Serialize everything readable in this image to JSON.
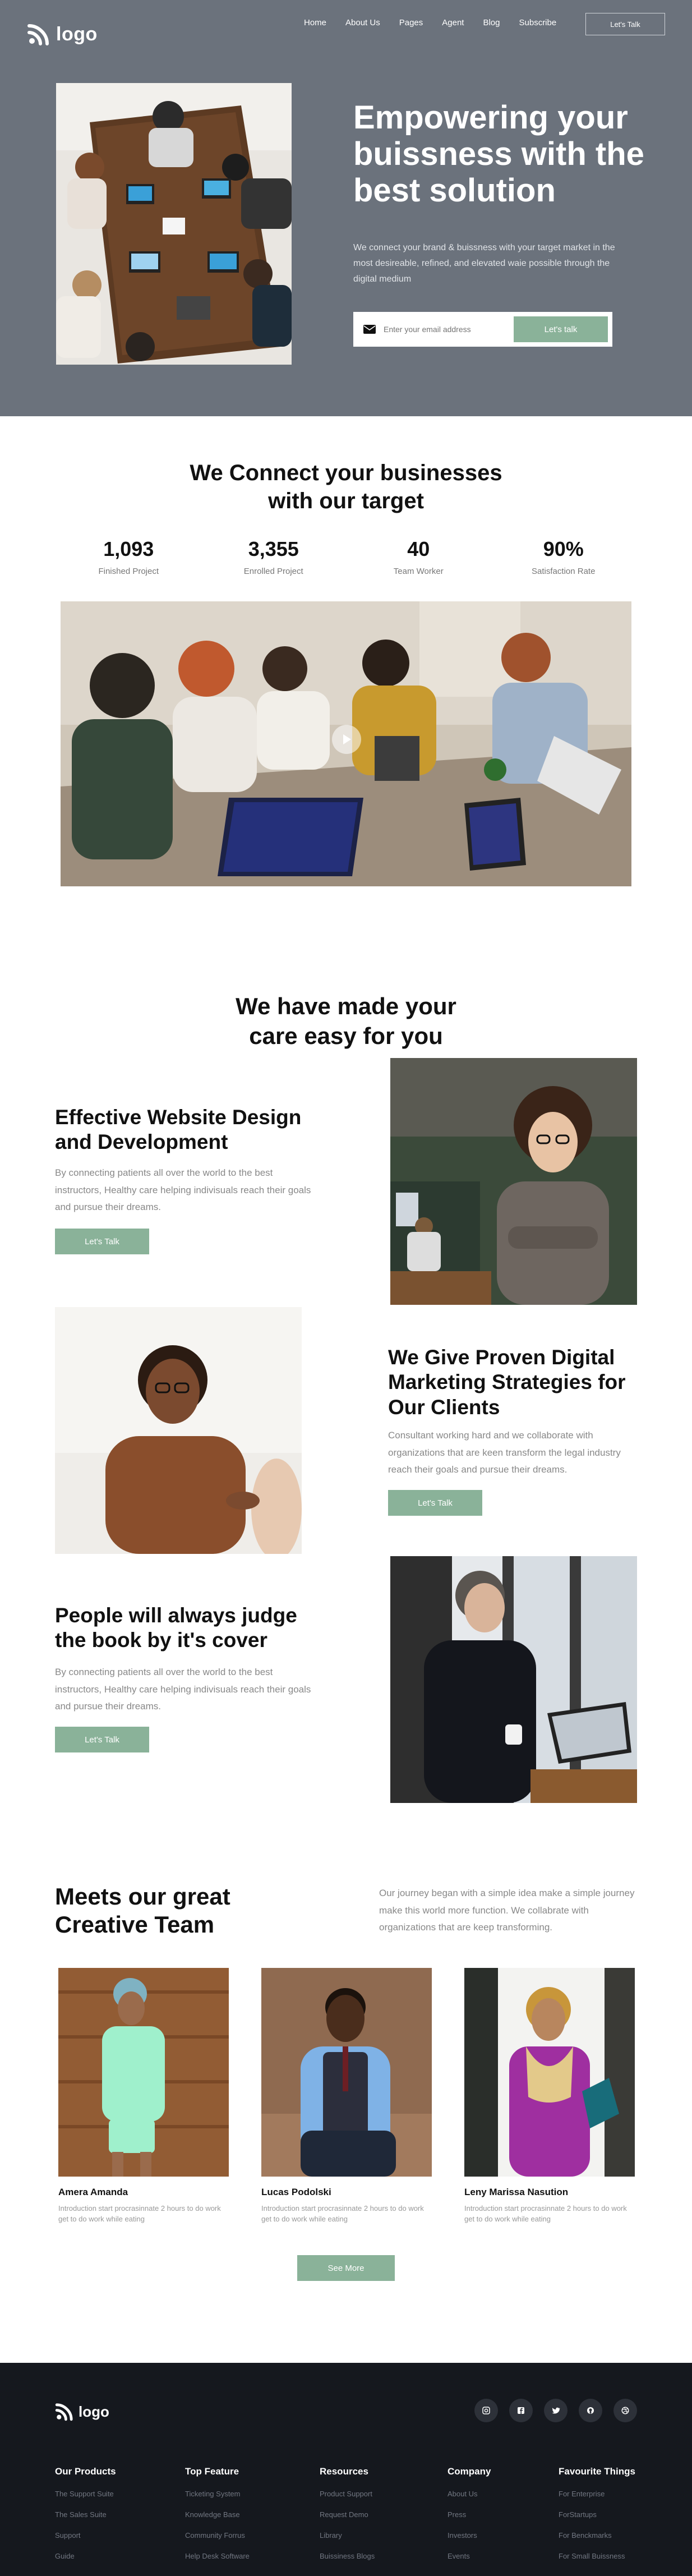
{
  "brand": {
    "logo_text": "logo"
  },
  "nav": {
    "items": [
      {
        "label": "Home"
      },
      {
        "label": "About Us"
      },
      {
        "label": "Pages"
      },
      {
        "label": "Agent"
      },
      {
        "label": "Blog"
      },
      {
        "label": "Subscribe"
      }
    ],
    "cta": "Let's Talk"
  },
  "hero": {
    "title": "Empowering your buissness with the best solution",
    "subtitle": "We connect your brand & buissness with your target market in the most desireable, refined, and elevated waie possible through the digital medium",
    "email_placeholder": "Enter your email address",
    "button": "Let's talk"
  },
  "connect": {
    "title_line1": "We Connect your businesses",
    "title_line2": "with our target",
    "stats": [
      {
        "value": "1,093",
        "label": "Finished Project"
      },
      {
        "value": "3,355",
        "label": "Enrolled Project"
      },
      {
        "value": "40",
        "label": "Team Worker"
      },
      {
        "value": "90%",
        "label": "Satisfaction Rate"
      }
    ]
  },
  "care": {
    "title_line1": "We have made your",
    "title_line2": "care easy for you",
    "features": [
      {
        "title": "Effective Website Design and Development",
        "text": "By connecting patients all over the world to the best instructors, Healthy care helping indivisuals reach their goals and pursue their dreams.",
        "button": "Let's Talk"
      },
      {
        "title": "We Give Proven Digital Marketing Strategies for Our Clients",
        "text": "Consultant working hard and we collaborate with organizations that are keen transform the legal industry reach their goals and pursue their dreams.",
        "button": "Let's Talk"
      },
      {
        "title": "People will always judge the book by it's cover",
        "text": "By connecting patients all over the world to the best instructors, Healthy care helping indivisuals reach their goals and pursue their dreams.",
        "button": "Let's Talk"
      }
    ]
  },
  "team": {
    "title": "Meets our great Creative Team",
    "intro": "Our journey began with a simple idea make a simple journey make this world more function. We collabrate with organizations that are keep transforming.",
    "members": [
      {
        "name": "Amera Amanda",
        "desc": "Introduction start procrasinnate 2 hours to do work get to do work while eating"
      },
      {
        "name": "Lucas Podolski",
        "desc": "Introduction start procrasinnate 2 hours to do work get to do work while eating"
      },
      {
        "name": "Leny Marissa Nasution",
        "desc": "Introduction start procrasinnate 2 hours to do work get to do work while eating"
      }
    ],
    "see_more": "See More"
  },
  "footer": {
    "logo_text": "logo",
    "socials": [
      "instagram-icon",
      "facebook-icon",
      "twitter-icon",
      "github-icon",
      "dribbble-icon"
    ],
    "columns": [
      {
        "head": "Our Products",
        "links": [
          "The Support Suite",
          "The Sales Suite",
          "Support",
          "Guide"
        ]
      },
      {
        "head": "Top Feature",
        "links": [
          "Ticketing System",
          "Knowledge Base",
          "Community Forrus",
          "Help Desk Software"
        ]
      },
      {
        "head": "Resources",
        "links": [
          "Product Support",
          "Request Demo",
          "Library",
          "Buissiness Blogs"
        ]
      },
      {
        "head": "Company",
        "links": [
          "About Us",
          "Press",
          "Investors",
          "Events"
        ]
      },
      {
        "head": "Favourite Things",
        "links": [
          "For Enterprise",
          "ForStartups",
          "For Benckmarks",
          "For Small Buissness"
        ]
      }
    ]
  },
  "colors": {
    "hero_bg": "#6b727c",
    "accent_green": "#8ab299",
    "footer_bg": "#15181e"
  }
}
